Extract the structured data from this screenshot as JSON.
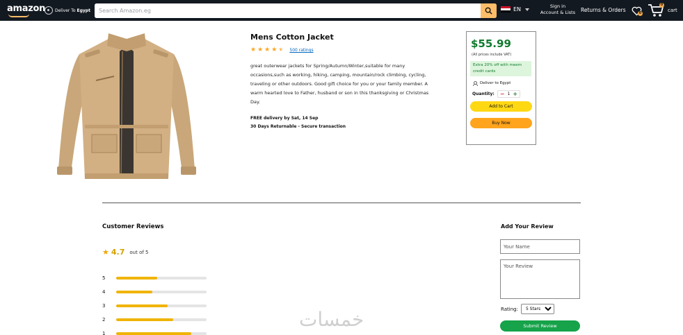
{
  "nav": {
    "logo": "amazon",
    "deliver_prefix": "Deliver To",
    "deliver_location": "Egypt",
    "search_placeholder": "Search Amazon.eg",
    "language": "EN",
    "signin_line1": "Sign in",
    "signin_line2": "Account & Lists",
    "returns": "Returns & Orders",
    "wishlist_count": "0",
    "cart_count": "0",
    "cart_label": "cart",
    "colors": {
      "bar": "#131921",
      "accent": "#febd69"
    }
  },
  "product": {
    "title": "Mens Cotton Jacket",
    "rating": 4.5,
    "ratings_link": "500 ratings",
    "description": "great outerwear jackets for Spring/Autumn/Winter,suitable for many occasions,such as working, hiking, camping, mountain/rock climbing, cycling, traveling or other outdoors. Good gift choice for you or your family member. A warm hearted love to Father, husband or son in this thanksgiving or Christmas Day.",
    "delivery_line1": "FREE delivery by Sat, 14 Sep",
    "delivery_line2": "30 Days Returnable - Secure transaction"
  },
  "buybox": {
    "price": "$55.99",
    "vat_note": "(All prices include VAT)",
    "offer": "Extra 20% off with meem credit cards",
    "deliver_to": "Deliver to Egypt",
    "quantity_label": "Quantity:",
    "quantity_value": "1",
    "add_to_cart": "Add to Cart",
    "buy_now": "Buy Now"
  },
  "reviews": {
    "title": "Customer Reviews",
    "average": "4.7",
    "out_of": "out of 5",
    "distribution": [
      {
        "stars": "5",
        "fraction": 0.45
      },
      {
        "stars": "4",
        "fraction": 0.4
      },
      {
        "stars": "3",
        "fraction": 0.57
      },
      {
        "stars": "2",
        "fraction": 0.63
      },
      {
        "stars": "1",
        "fraction": 0.83
      }
    ]
  },
  "add_review": {
    "title": "Add Your Review",
    "name_placeholder": "Your Name",
    "review_placeholder": "Your Review",
    "rating_label": "Rating:",
    "rating_value": "5 Stars",
    "submit": "Submit Review"
  },
  "watermark": "خمسات"
}
